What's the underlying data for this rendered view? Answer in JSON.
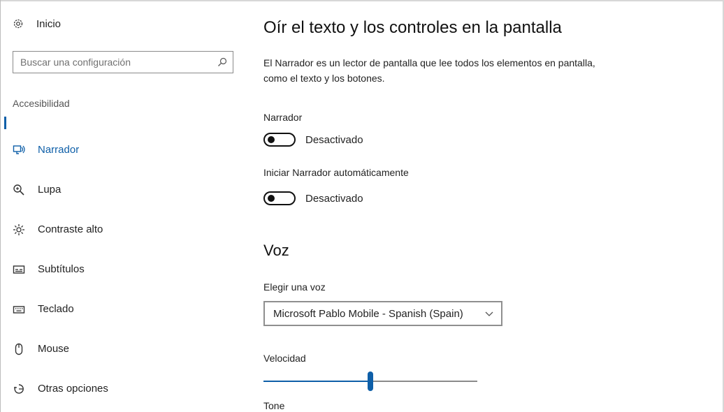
{
  "sidebar": {
    "home_label": "Inicio",
    "search_placeholder": "Buscar una configuración",
    "section_title": "Accesibilidad",
    "items": [
      {
        "label": "Narrador",
        "icon": "narrator-icon",
        "active": true
      },
      {
        "label": "Lupa",
        "icon": "magnifier-icon"
      },
      {
        "label": "Contraste alto",
        "icon": "brightness-icon"
      },
      {
        "label": "Subtítulos",
        "icon": "closed-captions-icon"
      },
      {
        "label": "Teclado",
        "icon": "keyboard-icon"
      },
      {
        "label": "Mouse",
        "icon": "mouse-icon"
      },
      {
        "label": "Otras opciones",
        "icon": "other-options-icon"
      }
    ]
  },
  "main": {
    "title": "Oír el texto y los controles en la pantalla",
    "description": "El Narrador es un lector de pantalla que lee todos los elementos en pantalla, como el texto y los botones.",
    "narrator_label": "Narrador",
    "narrator_state": "Desactivado",
    "autostart_label": "Iniciar Narrador automáticamente",
    "autostart_state": "Desactivado",
    "voice_heading": "Voz",
    "choose_voice_label": "Elegir una voz",
    "voice_value": "Microsoft Pablo Mobile - Spanish (Spain)",
    "speed_label": "Velocidad",
    "speed_value": 0.5,
    "tone_label": "Tone"
  },
  "colors": {
    "accent": "#0e5fa8",
    "text": "#1a1a1a",
    "border": "#8a8a8a"
  }
}
